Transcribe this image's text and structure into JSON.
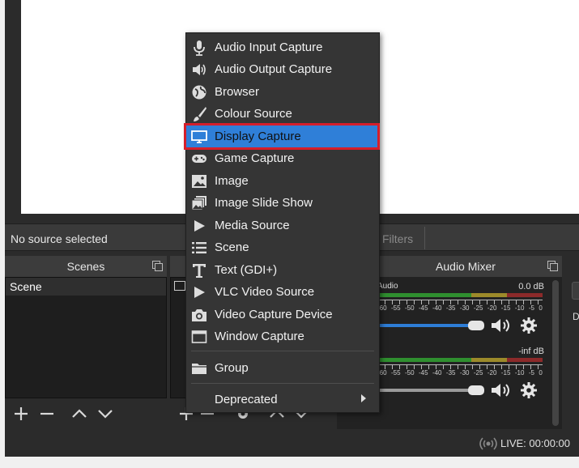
{
  "status": {
    "no_source": "No source selected",
    "filters": "Filters"
  },
  "scenes": {
    "title": "Scenes",
    "items": [
      "Scene"
    ]
  },
  "mixer": {
    "title": "Audio Mixer",
    "channels": [
      {
        "name": "Audio",
        "db": "0.0 dB",
        "volume_fraction": 0.97
      },
      {
        "name": "",
        "db": "-inf dB",
        "volume_fraction": 0.97
      }
    ],
    "tick_labels": [
      "-60",
      "-55",
      "-50",
      "-45",
      "-40",
      "-35",
      "-30",
      "-25",
      "-20",
      "-15",
      "-10",
      "-5",
      "0"
    ]
  },
  "right_dock": {
    "label": "Du"
  },
  "statusbar": {
    "live": "LIVE: 00:00:00"
  },
  "context_menu": {
    "items": [
      {
        "label": "Audio Input Capture",
        "icon": "microphone-icon"
      },
      {
        "label": "Audio Output Capture",
        "icon": "speaker-icon"
      },
      {
        "label": "Browser",
        "icon": "globe-icon"
      },
      {
        "label": "Colour Source",
        "icon": "paintbrush-icon"
      },
      {
        "label": "Display Capture",
        "icon": "monitor-icon",
        "highlighted": true
      },
      {
        "label": "Game Capture",
        "icon": "gamepad-icon"
      },
      {
        "label": "Image",
        "icon": "image-icon"
      },
      {
        "label": "Image Slide Show",
        "icon": "slideshow-icon"
      },
      {
        "label": "Media Source",
        "icon": "play-icon"
      },
      {
        "label": "Scene",
        "icon": "list-icon"
      },
      {
        "label": "Text (GDI+)",
        "icon": "text-icon"
      },
      {
        "label": "VLC Video Source",
        "icon": "play-icon"
      },
      {
        "label": "Video Capture Device",
        "icon": "camera-icon"
      },
      {
        "label": "Window Capture",
        "icon": "window-icon"
      }
    ],
    "group": {
      "label": "Group",
      "icon": "folder-icon"
    },
    "deprecated": {
      "label": "Deprecated"
    }
  },
  "colors": {
    "highlight": "#2f7fd8",
    "annotation_border": "#d51e2a",
    "panel": "#2b2b2b"
  }
}
